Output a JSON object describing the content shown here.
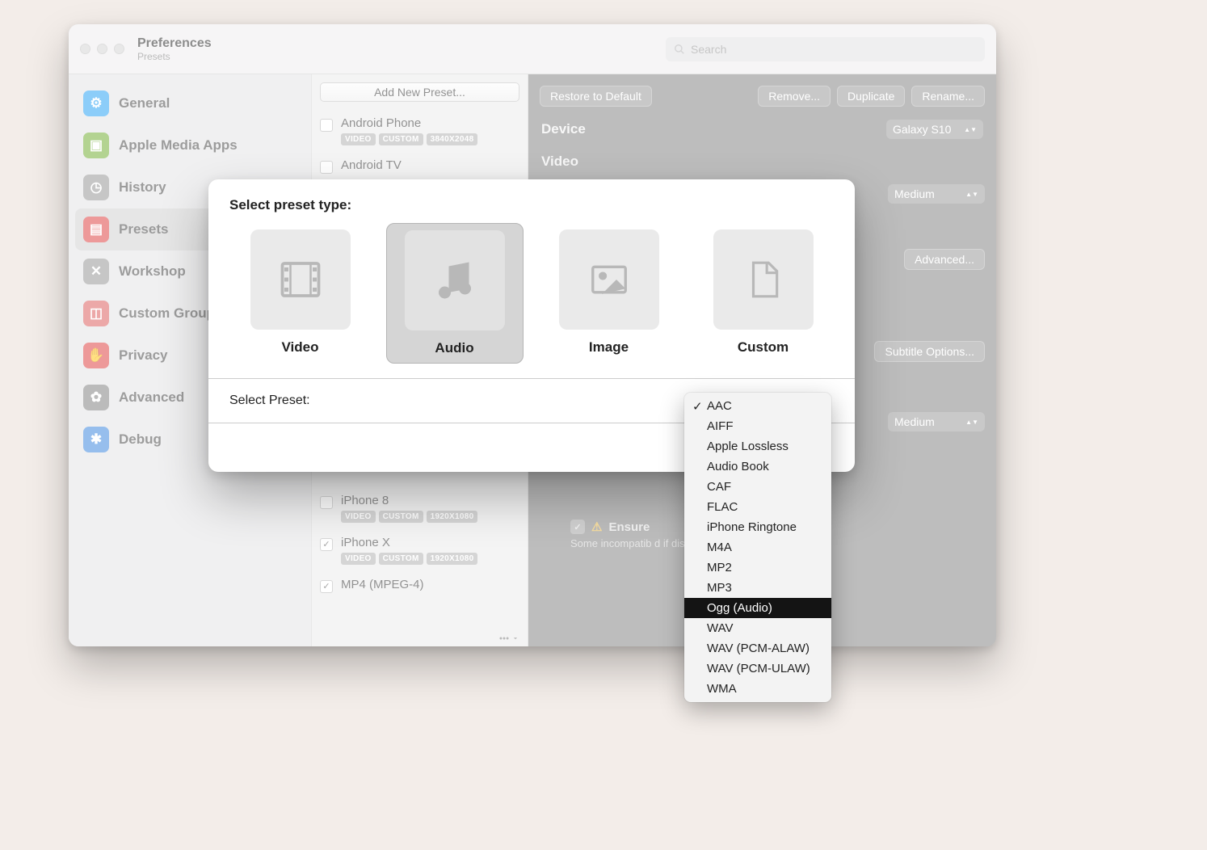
{
  "window": {
    "title": "Preferences",
    "subtitle": "Presets"
  },
  "search": {
    "placeholder": "Search"
  },
  "sidebar": {
    "items": [
      {
        "label": "General",
        "iconColor": "#3aa9f5"
      },
      {
        "label": "Apple Media Apps",
        "iconColor": "#7cb342"
      },
      {
        "label": "History",
        "iconColor": "#9e9e9e"
      },
      {
        "label": "Presets",
        "iconColor": "#e05050"
      },
      {
        "label": "Workshop",
        "iconColor": "#9e9e9e"
      },
      {
        "label": "Custom Groups",
        "iconColor": "#de6a6a"
      },
      {
        "label": "Privacy",
        "iconColor": "#e05050"
      },
      {
        "label": "Advanced",
        "iconColor": "#8a8a8a"
      },
      {
        "label": "Debug",
        "iconColor": "#4a8fe0"
      }
    ],
    "selectedIndex": 3
  },
  "middle": {
    "addButton": "Add New Preset...",
    "presets": [
      {
        "name": "Android Phone",
        "checked": false,
        "tags": [
          "VIDEO",
          "CUSTOM",
          "3840X2048"
        ]
      },
      {
        "name": "Android TV",
        "checked": false,
        "tags": []
      },
      {
        "name": "iPhone 8",
        "checked": false,
        "tags": [
          "VIDEO",
          "CUSTOM",
          "1920X1080"
        ]
      },
      {
        "name": "iPhone X",
        "checked": true,
        "tags": [
          "VIDEO",
          "CUSTOM",
          "1920X1080"
        ]
      },
      {
        "name": "MP4 (MPEG-4)",
        "checked": true,
        "tags": []
      }
    ]
  },
  "right": {
    "buttons": {
      "restore": "Restore to Default",
      "remove": "Remove...",
      "duplicate": "Duplicate",
      "rename": "Rename..."
    },
    "deviceLabel": "Device",
    "deviceValue": "Galaxy S10",
    "videoLabel": "Video",
    "quality1": "Medium",
    "advanced": "Advanced...",
    "subtitle": "Subtitle Options...",
    "quality2": "Medium",
    "ensure": "Ensure ",
    "ensureDesc": "Some incompatib                                        d if disabled."
  },
  "modal": {
    "title": "Select preset type:",
    "types": [
      {
        "label": "Video"
      },
      {
        "label": "Audio"
      },
      {
        "label": "Image"
      },
      {
        "label": "Custom"
      }
    ],
    "selectedType": 1,
    "selectPresetLabel": "Select Preset:"
  },
  "dropdown": {
    "items": [
      "AAC",
      "AIFF",
      "Apple Lossless",
      "Audio Book",
      "CAF",
      "FLAC",
      "iPhone Ringtone",
      "M4A",
      "MP2",
      "MP3",
      "Ogg (Audio)",
      "WAV",
      "WAV (PCM-ALAW)",
      "WAV (PCM-ULAW)",
      "WMA"
    ],
    "checkedIndex": 0,
    "highlightIndex": 10
  }
}
